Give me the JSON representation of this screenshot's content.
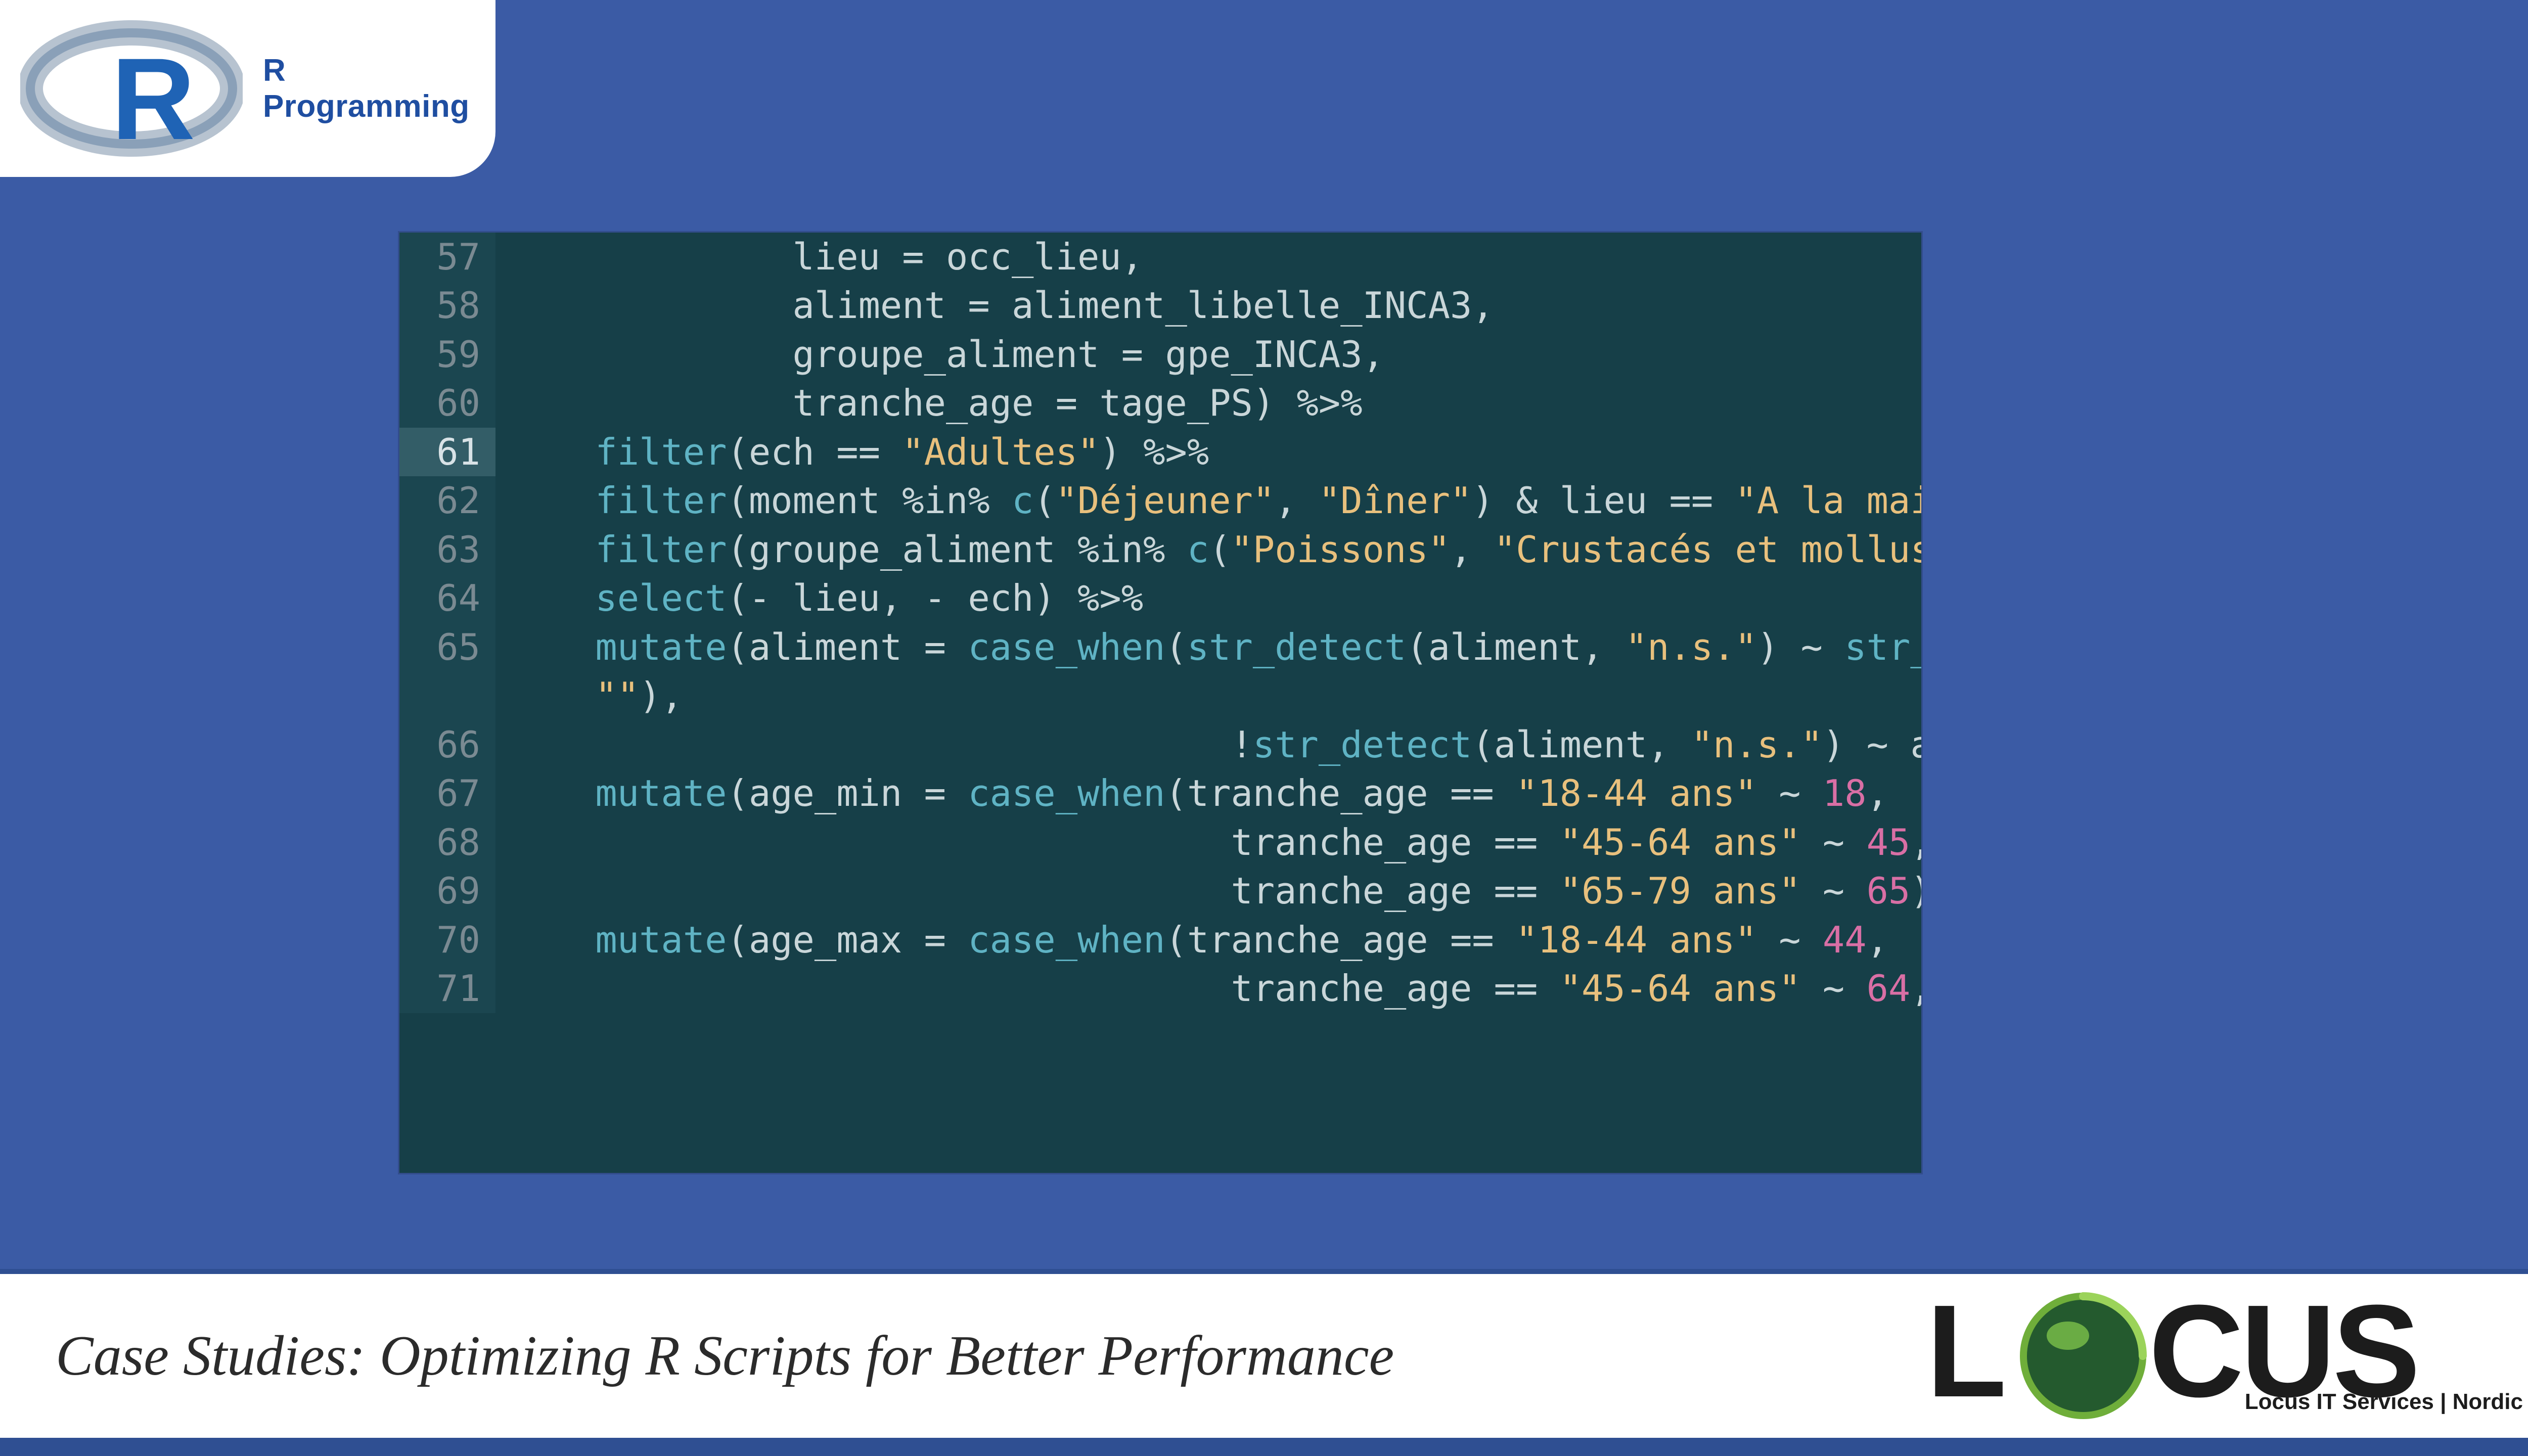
{
  "header": {
    "logo_label": "R Programming"
  },
  "code": {
    "lines": [
      {
        "num": "57",
        "hl": false,
        "tokens": [
          {
            "cls": "id",
            "t": "             lieu "
          },
          {
            "cls": "op",
            "t": "= "
          },
          {
            "cls": "id",
            "t": "occ_lieu"
          },
          {
            "cls": "op",
            "t": ","
          }
        ]
      },
      {
        "num": "58",
        "hl": false,
        "tokens": [
          {
            "cls": "id",
            "t": "             aliment "
          },
          {
            "cls": "op",
            "t": "= "
          },
          {
            "cls": "id",
            "t": "aliment_libelle_INCA3"
          },
          {
            "cls": "op",
            "t": ","
          }
        ]
      },
      {
        "num": "59",
        "hl": false,
        "tokens": [
          {
            "cls": "id",
            "t": "             groupe_aliment "
          },
          {
            "cls": "op",
            "t": "= "
          },
          {
            "cls": "id",
            "t": "gpe_INCA3"
          },
          {
            "cls": "op",
            "t": ","
          }
        ]
      },
      {
        "num": "60",
        "hl": false,
        "tokens": [
          {
            "cls": "id",
            "t": "             tranche_age "
          },
          {
            "cls": "op",
            "t": "= "
          },
          {
            "cls": "id",
            "t": "tage_PS"
          },
          {
            "cls": "op",
            "t": ") "
          },
          {
            "cls": "pipe",
            "t": "%>%"
          }
        ]
      },
      {
        "num": "61",
        "hl": true,
        "tokens": [
          {
            "cls": "id",
            "t": "    "
          },
          {
            "cls": "fn",
            "t": "filter"
          },
          {
            "cls": "op",
            "t": "("
          },
          {
            "cls": "id",
            "t": "ech "
          },
          {
            "cls": "op",
            "t": "== "
          },
          {
            "cls": "str",
            "t": "\"Adultes\""
          },
          {
            "cls": "op",
            "t": ") "
          },
          {
            "cls": "pipe",
            "t": "%>%"
          }
        ]
      },
      {
        "num": "62",
        "hl": false,
        "tokens": [
          {
            "cls": "id",
            "t": "    "
          },
          {
            "cls": "fn",
            "t": "filter"
          },
          {
            "cls": "op",
            "t": "("
          },
          {
            "cls": "id",
            "t": "moment "
          },
          {
            "cls": "kw",
            "t": "%in% "
          },
          {
            "cls": "fn",
            "t": "c"
          },
          {
            "cls": "op",
            "t": "("
          },
          {
            "cls": "str",
            "t": "\"Déjeuner\""
          },
          {
            "cls": "op",
            "t": ", "
          },
          {
            "cls": "str",
            "t": "\"Dîner\""
          },
          {
            "cls": "op",
            "t": ") & "
          },
          {
            "cls": "id",
            "t": "lieu "
          },
          {
            "cls": "op",
            "t": "== "
          },
          {
            "cls": "str",
            "t": "\"A la maison\""
          },
          {
            "cls": "op",
            "t": ") "
          },
          {
            "cls": "pipe",
            "t": "%>%"
          }
        ]
      },
      {
        "num": "63",
        "hl": false,
        "tokens": [
          {
            "cls": "id",
            "t": "    "
          },
          {
            "cls": "fn",
            "t": "filter"
          },
          {
            "cls": "op",
            "t": "("
          },
          {
            "cls": "id",
            "t": "groupe_aliment "
          },
          {
            "cls": "kw",
            "t": "%in% "
          },
          {
            "cls": "fn",
            "t": "c"
          },
          {
            "cls": "op",
            "t": "("
          },
          {
            "cls": "str",
            "t": "\"Poissons\""
          },
          {
            "cls": "op",
            "t": ", "
          },
          {
            "cls": "str",
            "t": "\"Crustacés et mollusques\""
          },
          {
            "cls": "op",
            "t": ")) "
          },
          {
            "cls": "pipe",
            "t": "%"
          }
        ]
      },
      {
        "num": "64",
        "hl": false,
        "tokens": [
          {
            "cls": "id",
            "t": "    "
          },
          {
            "cls": "fn",
            "t": "select"
          },
          {
            "cls": "op",
            "t": "(- "
          },
          {
            "cls": "id",
            "t": "lieu"
          },
          {
            "cls": "op",
            "t": ", - "
          },
          {
            "cls": "id",
            "t": "ech"
          },
          {
            "cls": "op",
            "t": ") "
          },
          {
            "cls": "pipe",
            "t": "%>%"
          }
        ]
      },
      {
        "num": "65",
        "hl": false,
        "tokens": [
          {
            "cls": "id",
            "t": "    "
          },
          {
            "cls": "fn",
            "t": "mutate"
          },
          {
            "cls": "op",
            "t": "("
          },
          {
            "cls": "id",
            "t": "aliment "
          },
          {
            "cls": "op",
            "t": "= "
          },
          {
            "cls": "fn",
            "t": "case_when"
          },
          {
            "cls": "op",
            "t": "("
          },
          {
            "cls": "fn",
            "t": "str_detect"
          },
          {
            "cls": "op",
            "t": "("
          },
          {
            "cls": "id",
            "t": "aliment"
          },
          {
            "cls": "op",
            "t": ", "
          },
          {
            "cls": "str",
            "t": "\"n.s.\""
          },
          {
            "cls": "op",
            "t": ") ~ "
          },
          {
            "cls": "fn",
            "t": "str_replace_a"
          }
        ]
      },
      {
        "num": "",
        "hl": false,
        "tokens": [
          {
            "cls": "id",
            "t": "    "
          },
          {
            "cls": "str",
            "t": "\"\""
          },
          {
            "cls": "op",
            "t": "),"
          }
        ]
      },
      {
        "num": "66",
        "hl": false,
        "tokens": [
          {
            "cls": "id",
            "t": "                                 "
          },
          {
            "cls": "bang",
            "t": "!"
          },
          {
            "cls": "fn",
            "t": "str_detect"
          },
          {
            "cls": "op",
            "t": "("
          },
          {
            "cls": "id",
            "t": "aliment"
          },
          {
            "cls": "op",
            "t": ", "
          },
          {
            "cls": "str",
            "t": "\"n.s.\""
          },
          {
            "cls": "op",
            "t": ") ~ "
          },
          {
            "cls": "id",
            "t": "aliment"
          },
          {
            "cls": "op",
            "t": ")) "
          },
          {
            "cls": "pipe",
            "t": "%>"
          }
        ]
      },
      {
        "num": "67",
        "hl": false,
        "tokens": [
          {
            "cls": "id",
            "t": "    "
          },
          {
            "cls": "fn",
            "t": "mutate"
          },
          {
            "cls": "op",
            "t": "("
          },
          {
            "cls": "id",
            "t": "age_min "
          },
          {
            "cls": "op",
            "t": "= "
          },
          {
            "cls": "fn",
            "t": "case_when"
          },
          {
            "cls": "op",
            "t": "("
          },
          {
            "cls": "id",
            "t": "tranche_age "
          },
          {
            "cls": "op",
            "t": "== "
          },
          {
            "cls": "str",
            "t": "\"18-44 ans\""
          },
          {
            "cls": "op",
            "t": " ~ "
          },
          {
            "cls": "num",
            "t": "18"
          },
          {
            "cls": "op",
            "t": ","
          }
        ]
      },
      {
        "num": "68",
        "hl": false,
        "tokens": [
          {
            "cls": "id",
            "t": "                                 "
          },
          {
            "cls": "id",
            "t": "tranche_age "
          },
          {
            "cls": "op",
            "t": "== "
          },
          {
            "cls": "str",
            "t": "\"45-64 ans\""
          },
          {
            "cls": "op",
            "t": " ~ "
          },
          {
            "cls": "num",
            "t": "45"
          },
          {
            "cls": "op",
            "t": ","
          }
        ]
      },
      {
        "num": "69",
        "hl": false,
        "tokens": [
          {
            "cls": "id",
            "t": "                                 "
          },
          {
            "cls": "id",
            "t": "tranche_age "
          },
          {
            "cls": "op",
            "t": "== "
          },
          {
            "cls": "str",
            "t": "\"65-79 ans\""
          },
          {
            "cls": "op",
            "t": " ~ "
          },
          {
            "cls": "num",
            "t": "65"
          },
          {
            "cls": "op",
            "t": ")) "
          },
          {
            "cls": "pipe",
            "t": "%>%"
          }
        ]
      },
      {
        "num": "70",
        "hl": false,
        "tokens": [
          {
            "cls": "id",
            "t": "    "
          },
          {
            "cls": "fn",
            "t": "mutate"
          },
          {
            "cls": "op",
            "t": "("
          },
          {
            "cls": "id",
            "t": "age_max "
          },
          {
            "cls": "op",
            "t": "= "
          },
          {
            "cls": "fn",
            "t": "case_when"
          },
          {
            "cls": "op",
            "t": "("
          },
          {
            "cls": "id",
            "t": "tranche_age "
          },
          {
            "cls": "op",
            "t": "== "
          },
          {
            "cls": "str",
            "t": "\"18-44 ans\""
          },
          {
            "cls": "op",
            "t": " ~ "
          },
          {
            "cls": "num",
            "t": "44"
          },
          {
            "cls": "op",
            "t": ","
          }
        ]
      },
      {
        "num": "71",
        "hl": false,
        "tokens": [
          {
            "cls": "id",
            "t": "                                 "
          },
          {
            "cls": "id",
            "t": "tranche_age "
          },
          {
            "cls": "op",
            "t": "== "
          },
          {
            "cls": "str",
            "t": "\"45-64 ans\""
          },
          {
            "cls": "op",
            "t": " ~ "
          },
          {
            "cls": "num",
            "t": "64"
          },
          {
            "cls": "op",
            "t": ","
          }
        ]
      }
    ]
  },
  "footer": {
    "caption": "Case Studies: Optimizing R Scripts for Better Performance",
    "company_sub": "Locus IT Services | Nordic",
    "brand_letters": {
      "l": "L",
      "cus": "CUS"
    }
  }
}
